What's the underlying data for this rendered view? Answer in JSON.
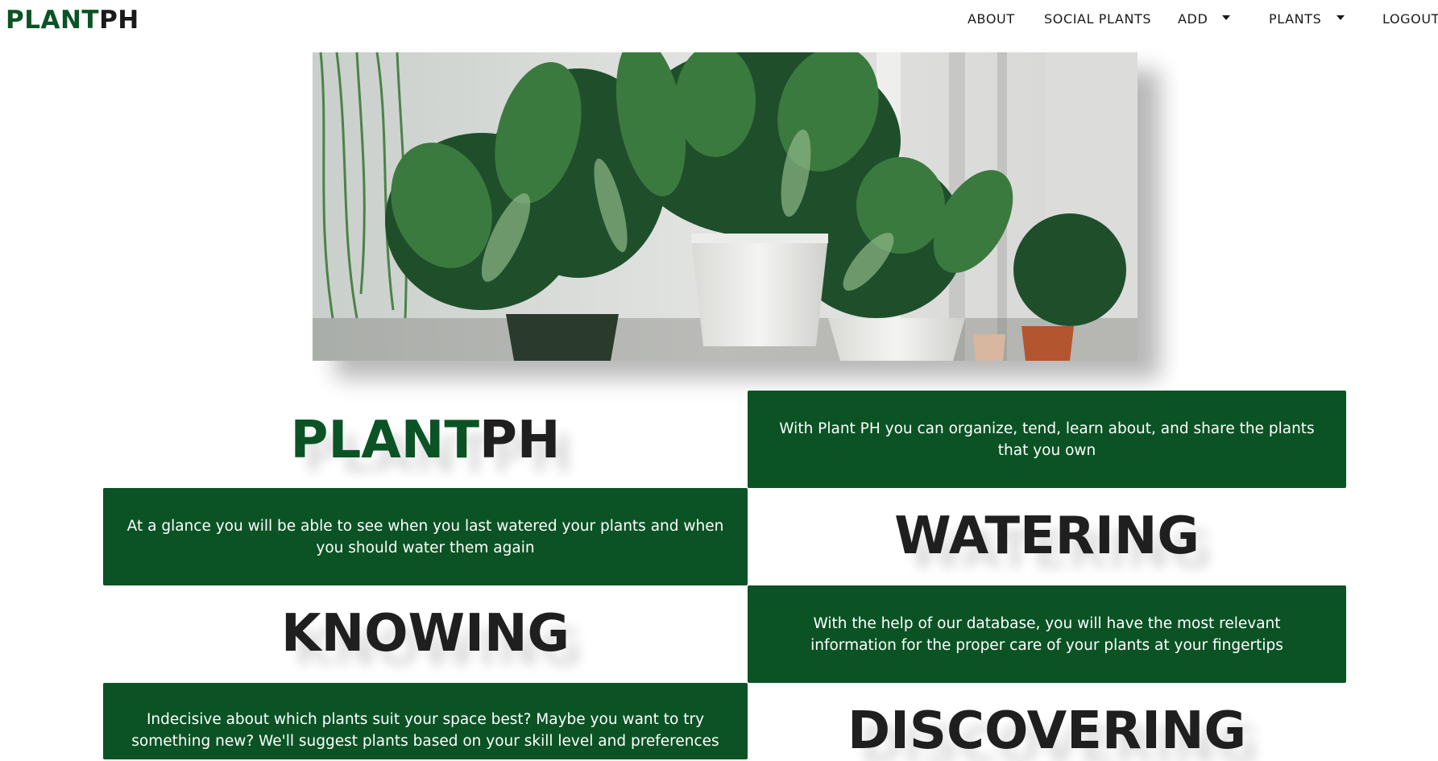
{
  "nav": {
    "brand_green": "PLANT",
    "brand_dark": "PH",
    "about": "ABOUT",
    "social": "SOCIAL PLANTS",
    "add": "ADD",
    "plants": "PLANTS",
    "logout": "LOGOUT"
  },
  "hero": {
    "image_alt": "potted-plants-photo"
  },
  "features": {
    "brand_green": "PLANT",
    "brand_dark": "PH",
    "intro_text": "With Plant PH you can organize, tend, learn about, and share the plants that you own",
    "watering_text": "At a glance you will be able to see when you last watered your plants and when you should water them again",
    "watering_heading": "WATERING",
    "knowing_heading": "KNOWING",
    "knowing_text": "With the help of our database, you will have the most relevant information for the proper care of your plants at your fingertips",
    "discovering_text": "Indecisive about which plants suit your space best? Maybe you want to try something new? We'll suggest plants based on your skill level and preferences",
    "discovering_heading": "DISCOVERING"
  },
  "colors": {
    "brand_green": "#0b5324",
    "text_dark": "#1f1f1f",
    "box_text": "#ffffff"
  }
}
